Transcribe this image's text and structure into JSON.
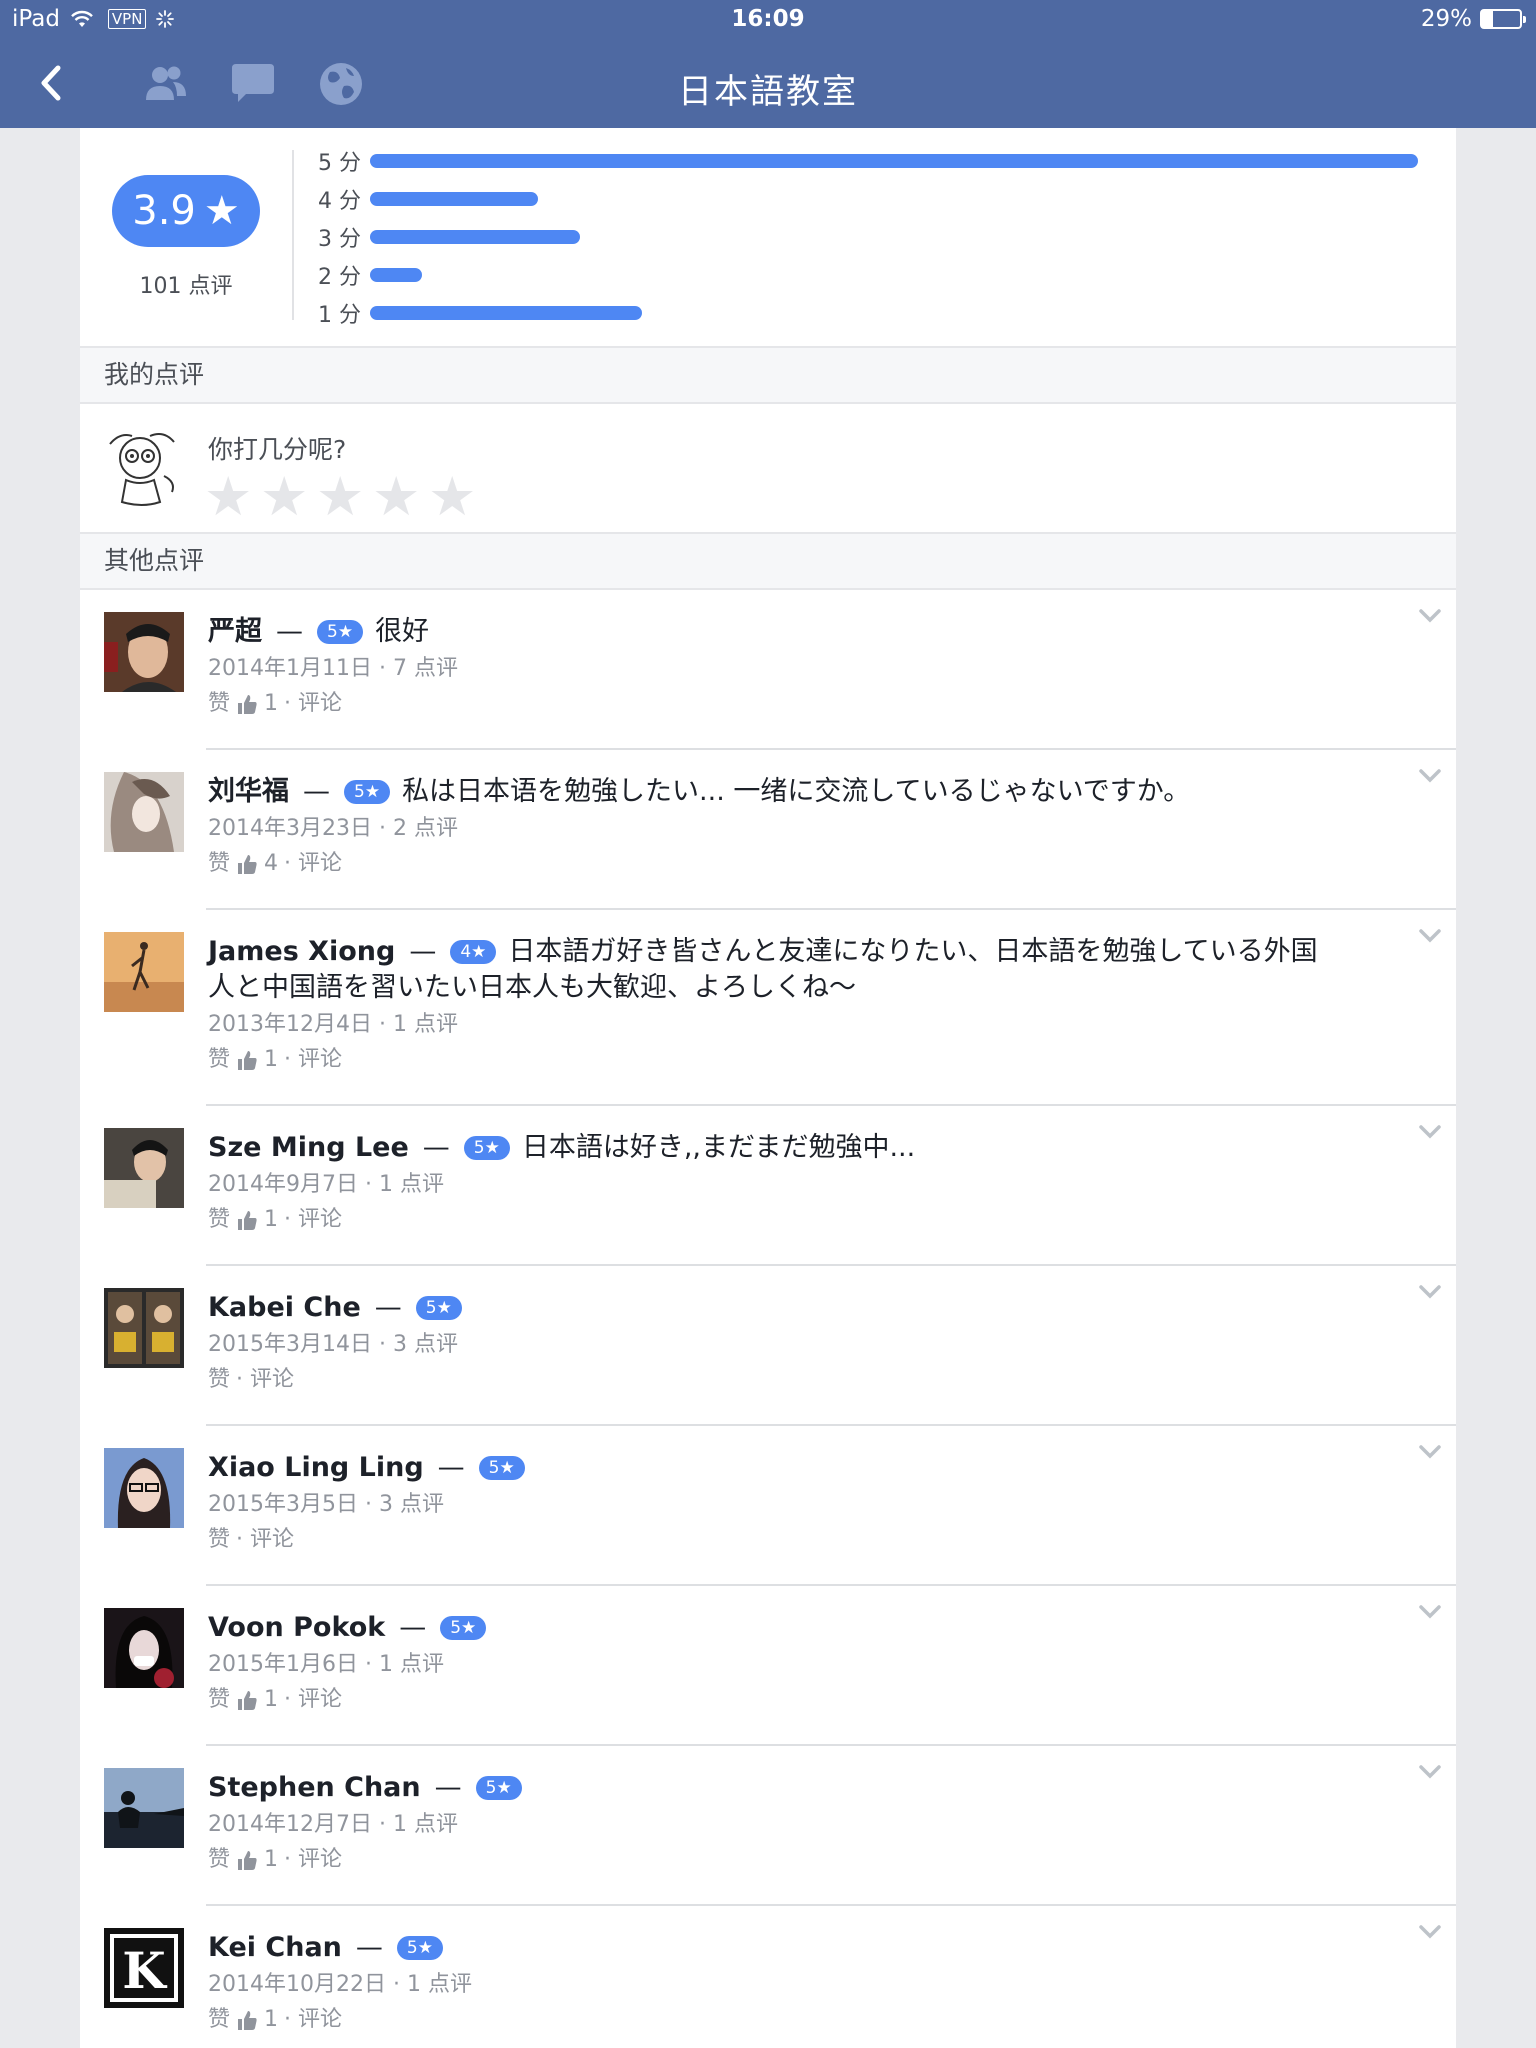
{
  "status_bar": {
    "device": "iPad",
    "vpn": "VPN",
    "time": "16:09",
    "battery_pct": "29%",
    "battery_level": 0.29
  },
  "nav": {
    "title": "日本語教室",
    "icons": [
      "back-chevron-icon",
      "friends-icon",
      "message-icon",
      "globe-icon"
    ]
  },
  "summary": {
    "score": "3.9",
    "star_glyph": "★",
    "review_count": "101 点评",
    "distribution": [
      {
        "label": "5 分",
        "fraction": 1.0
      },
      {
        "label": "4 分",
        "fraction": 0.16
      },
      {
        "label": "3 分",
        "fraction": 0.2
      },
      {
        "label": "2 分",
        "fraction": 0.05
      },
      {
        "label": "1 分",
        "fraction": 0.26
      }
    ],
    "accent_color": "#4e87f3"
  },
  "my_review": {
    "section_title": "我的点评",
    "prompt": "你打几分呢?",
    "stars": [
      "★",
      "★",
      "★",
      "★",
      "★"
    ]
  },
  "other_reviews": {
    "section_title": "其他点评",
    "items": [
      {
        "name": "严超",
        "rating": "5★",
        "text": "很好",
        "meta": "2014年1月11日 · 7 点评",
        "like_label": "赞",
        "likes": "1",
        "comment_label": "· 评论",
        "has_likes": true
      },
      {
        "name": "刘华福",
        "rating": "5★",
        "text": "私は日本语を勉強したい... 一绪に交流しているじゃないですか。",
        "meta": "2014年3月23日 · 2 点评",
        "like_label": "赞",
        "likes": "4",
        "comment_label": "· 评论",
        "has_likes": true
      },
      {
        "name": "James Xiong",
        "rating": "4★",
        "text": "日本語ガ好き皆さんと友達になりたい、日本語を勉強している外国人と中国語を習いたい日本人も大歓迎、よろしくね～",
        "meta": "2013年12月4日 · 1 点评",
        "like_label": "赞",
        "likes": "1",
        "comment_label": "· 评论",
        "has_likes": true
      },
      {
        "name": "Sze Ming Lee",
        "rating": "5★",
        "text": "日本語は好き,,まだまだ勉強中...",
        "meta": "2014年9月7日 · 1 点评",
        "like_label": "赞",
        "likes": "1",
        "comment_label": "· 评论",
        "has_likes": true
      },
      {
        "name": "Kabei Che",
        "rating": "5★",
        "text": "",
        "meta": "2015年3月14日 · 3 点评",
        "like_label": "赞",
        "likes": "",
        "comment_label": "· 评论",
        "has_likes": false
      },
      {
        "name": "Xiao Ling Ling",
        "rating": "5★",
        "text": "",
        "meta": "2015年3月5日 · 3 点评",
        "like_label": "赞",
        "likes": "",
        "comment_label": "· 评论",
        "has_likes": false
      },
      {
        "name": "Voon Pokok",
        "rating": "5★",
        "text": "",
        "meta": "2015年1月6日 · 1 点评",
        "like_label": "赞",
        "likes": "1",
        "comment_label": "· 评论",
        "has_likes": true
      },
      {
        "name": "Stephen Chan",
        "rating": "5★",
        "text": "",
        "meta": "2014年12月7日 · 1 点评",
        "like_label": "赞",
        "likes": "1",
        "comment_label": "· 评论",
        "has_likes": true
      },
      {
        "name": "Kei Chan",
        "rating": "5★",
        "text": "",
        "meta": "2014年10月22日 · 1 点评",
        "like_label": "赞",
        "likes": "1",
        "comment_label": "· 评论",
        "has_likes": true
      }
    ]
  }
}
